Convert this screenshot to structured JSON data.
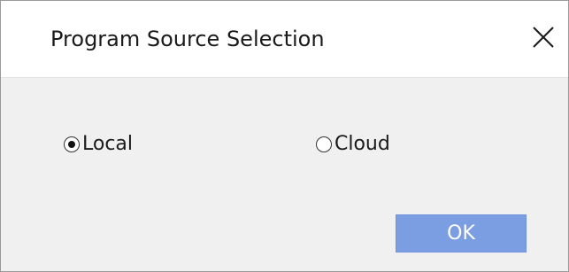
{
  "dialog": {
    "title": "Program Source Selection",
    "close_icon": "close-icon",
    "options": [
      {
        "label": "Local",
        "selected": true
      },
      {
        "label": "Cloud",
        "selected": false
      }
    ],
    "ok_label": "OK"
  },
  "colors": {
    "body_background": "#f0f0f0",
    "titlebar_background": "#ffffff",
    "ok_button": "#7b9ee3",
    "ok_text": "#ffffff"
  }
}
